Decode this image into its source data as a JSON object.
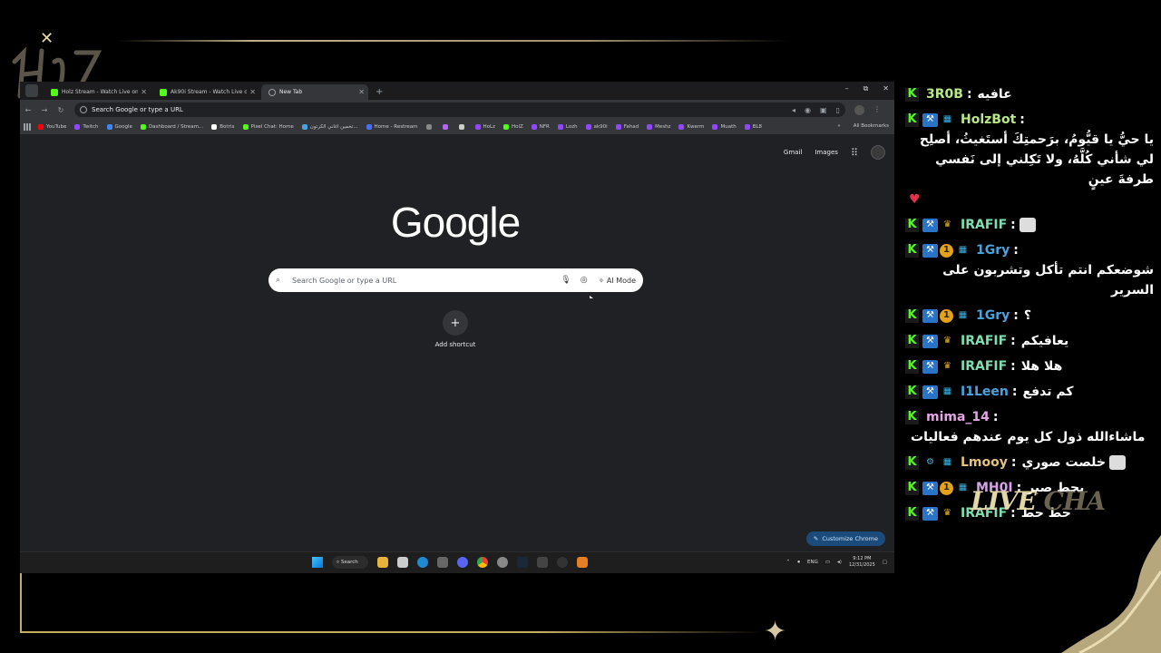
{
  "browser": {
    "tabs": [
      {
        "label": "Holz Stream - Watch Live on Ki",
        "icon": "kick-icon",
        "active": false
      },
      {
        "label": "Ak90i Stream - Watch Live on K",
        "icon": "kick-icon",
        "active": false
      },
      {
        "label": "New Tab",
        "icon": "globe-icon",
        "active": true
      }
    ],
    "new_tab_symbol": "+",
    "window_controls": [
      "–",
      "⧉",
      "✕"
    ],
    "omnibox_text": "Search Google or type a URL",
    "bookmarks": [
      {
        "label": "YouTube",
        "color": "#ff0000"
      },
      {
        "label": "Twitch",
        "color": "#9146ff"
      },
      {
        "label": "Google",
        "color": "#4285f4"
      },
      {
        "label": "Dashboard / Stream...",
        "color": "#53fc18"
      },
      {
        "label": "Botrix",
        "color": "#ffffff"
      },
      {
        "label": "Pixel Chat: Home",
        "color": "#53fc18"
      },
      {
        "label": "تخمين اغاني الكرتون...",
        "color": "#4aa3df"
      },
      {
        "label": "Home - Restream",
        "color": "#4a6cf7"
      },
      {
        "label": "",
        "color": "#888888"
      },
      {
        "label": "",
        "color": "#b565f5"
      },
      {
        "label": "",
        "color": "#cccccc"
      },
      {
        "label": "HoLz",
        "color": "#9146ff"
      },
      {
        "label": "HolZ",
        "color": "#53fc18"
      },
      {
        "label": "NFR",
        "color": "#9146ff"
      },
      {
        "label": "Lozh",
        "color": "#9146ff"
      },
      {
        "label": "ak90i",
        "color": "#9146ff"
      },
      {
        "label": "Fahad",
        "color": "#9146ff"
      },
      {
        "label": "Meshz",
        "color": "#9146ff"
      },
      {
        "label": "Kwerm",
        "color": "#9146ff"
      },
      {
        "label": "Muath",
        "color": "#9146ff"
      },
      {
        "label": "BL8",
        "color": "#9146ff"
      }
    ],
    "bookmarks_more": "»",
    "all_bookmarks": "All Bookmarks"
  },
  "newtab": {
    "gmail": "Gmail",
    "images": "Images",
    "logo": "Google",
    "search_placeholder": "Search Google or type a URL",
    "ai_mode": "AI Mode",
    "add_shortcut_symbol": "+",
    "add_shortcut_label": "Add shortcut",
    "customize": "Customize Chrome"
  },
  "taskbar": {
    "search": "Search",
    "lang": "ENG",
    "time": "9:12 PM",
    "date": "12/31/2025"
  },
  "chat": {
    "messages": [
      {
        "user": "3R0B",
        "user_color": "#b8e986",
        "badges": [],
        "text": "عافيه"
      },
      {
        "user": "HolzBot",
        "user_color": "#b8e986",
        "badges": [
          "mod",
          "sub"
        ],
        "text": "يا حيُّ يا قيُّومُ، برَحمتِكَ أستَغيثُ، أصلِح لي شأني كُلَّهُ، ولا تَكِلني إلى نَفسي طرفةَ عينٍ",
        "heart": true
      },
      {
        "user": "IRAFIF",
        "user_color": "#7ee0b0",
        "badges": [
          "mod",
          "vip"
        ],
        "text": "",
        "emote": true
      },
      {
        "user": "1Gry",
        "user_color": "#4aa3df",
        "badges": [
          "mod",
          "og",
          "sub"
        ],
        "text": "شوضعكم انتم تأكل وتشربون على السرير"
      },
      {
        "user": "1Gry",
        "user_color": "#4aa3df",
        "badges": [
          "mod",
          "og",
          "sub"
        ],
        "text": "؟"
      },
      {
        "user": "IRAFIF",
        "user_color": "#7ee0b0",
        "badges": [
          "mod",
          "vip"
        ],
        "text": "يعافيكم"
      },
      {
        "user": "IRAFIF",
        "user_color": "#7ee0b0",
        "badges": [
          "mod",
          "vip"
        ],
        "text": "هلا هلا"
      },
      {
        "user": "I1Leen",
        "user_color": "#4aa3df",
        "badges": [
          "mod",
          "sub"
        ],
        "text": "كم تدفع"
      },
      {
        "user": "mima_14",
        "user_color": "#e6a6e6",
        "badges": [],
        "text": "ماشاءالله ذول كل يوم عندهم فعاليات"
      },
      {
        "user": "Lmooy",
        "user_color": "#e6c27a",
        "badges": [
          "sub2",
          "sub"
        ],
        "text": "خلصت صوري",
        "emote": true
      },
      {
        "user": "MH0I",
        "user_color": "#d6a2e8",
        "badges": [
          "mod",
          "og",
          "sub"
        ],
        "text": "بحط صبر"
      },
      {
        "user": "IRAFIF",
        "user_color": "#7ee0b0",
        "badges": [
          "mod",
          "vip"
        ],
        "text": "حط حط"
      }
    ],
    "title_main": "LIVE",
    "title_fade": "CHA"
  },
  "colors": {
    "kick_green": "#53fc18",
    "gold": "#c7ad62",
    "chrome_dark": "#202124"
  }
}
